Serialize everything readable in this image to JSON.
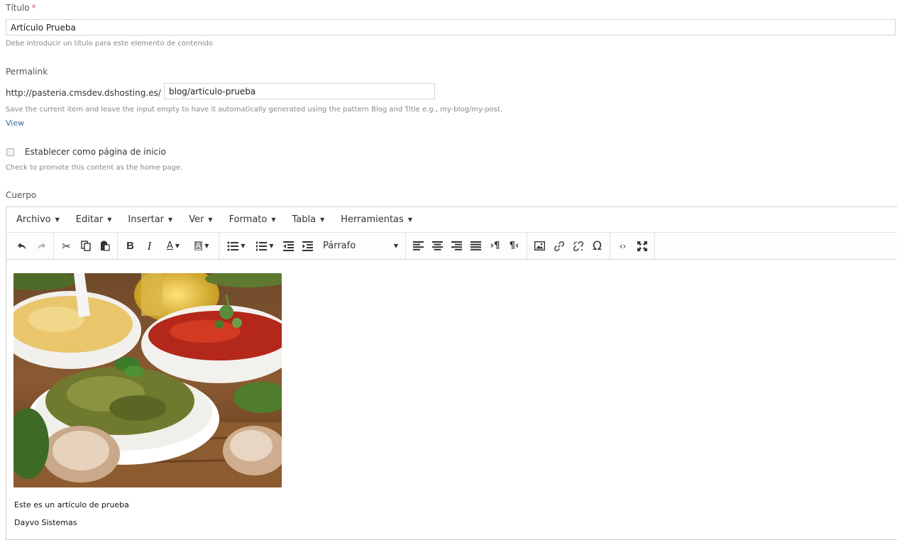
{
  "titulo": {
    "label": "Título",
    "required_mark": "*",
    "value": "Artículo Prueba",
    "help": "Debe introducir un título para este elemento de contenido"
  },
  "permalink": {
    "label": "Permalink",
    "prefix": "http://pasteria.cmsdev.dshosting.es/",
    "value": "blog/articulo-prueba",
    "help": "Save the current item and leave the input empty to have it automatically generated using the pattern Blog and Title e.g., my-blog/my-post.",
    "view_link": "View"
  },
  "homepage": {
    "label": "Establecer como página de inicio",
    "help": "Check to promote this content as the home page.",
    "checked": false
  },
  "cuerpo": {
    "label": "Cuerpo",
    "menu": [
      "Archivo",
      "Editar",
      "Insertar",
      "Ver",
      "Formato",
      "Tabla",
      "Herramientas"
    ],
    "format_select": "Párrafo",
    "content": {
      "paragraph1": "Este es un artículo de prueba",
      "paragraph2": "Dayvo Sistemas"
    }
  }
}
